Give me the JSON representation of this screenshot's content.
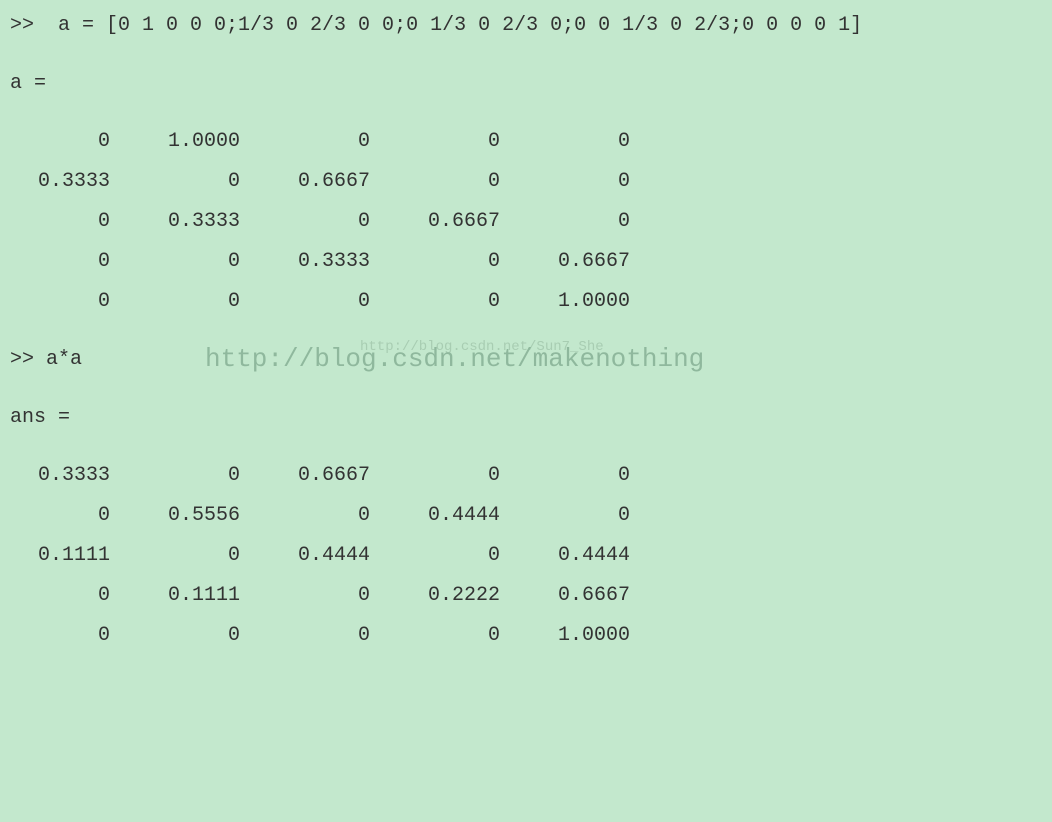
{
  "prompt1": ">>  a = [0 1 0 0 0;1/3 0 2/3 0 0;0 1/3 0 2/3 0;0 0 1/3 0 2/3;0 0 0 0 1]",
  "var1": "a =",
  "matrix1": {
    "rows": [
      [
        "0",
        "1.0000",
        "0",
        "0",
        "0"
      ],
      [
        "0.3333",
        "0",
        "0.6667",
        "0",
        "0"
      ],
      [
        "0",
        "0.3333",
        "0",
        "0.6667",
        "0"
      ],
      [
        "0",
        "0",
        "0.3333",
        "0",
        "0.6667"
      ],
      [
        "0",
        "0",
        "0",
        "0",
        "1.0000"
      ]
    ]
  },
  "prompt2": ">> a*a",
  "watermark_large": "http://blog.csdn.net/makenothing",
  "watermark_small": "http://blog.csdn.net/Sun7_She",
  "var2": "ans =",
  "matrix2": {
    "rows": [
      [
        "0.3333",
        "0",
        "0.6667",
        "0",
        "0"
      ],
      [
        "0",
        "0.5556",
        "0",
        "0.4444",
        "0"
      ],
      [
        "0.1111",
        "0",
        "0.4444",
        "0",
        "0.4444"
      ],
      [
        "0",
        "0.1111",
        "0",
        "0.2222",
        "0.6667"
      ],
      [
        "0",
        "0",
        "0",
        "0",
        "1.0000"
      ]
    ]
  }
}
